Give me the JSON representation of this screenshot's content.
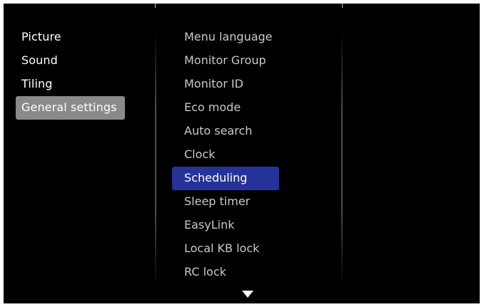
{
  "left_menu": {
    "items": [
      {
        "label": "Picture"
      },
      {
        "label": "Sound"
      },
      {
        "label": "Tiling"
      },
      {
        "label": "General settings"
      }
    ],
    "active_label": "General settings"
  },
  "right_menu": {
    "items": [
      {
        "label": "Menu language"
      },
      {
        "label": "Monitor Group"
      },
      {
        "label": "Monitor ID"
      },
      {
        "label": "Eco mode"
      },
      {
        "label": "Auto search"
      },
      {
        "label": "Clock"
      },
      {
        "label": "Scheduling"
      },
      {
        "label": "Sleep timer"
      },
      {
        "label": "EasyLink"
      },
      {
        "label": "Local KB lock"
      },
      {
        "label": "RC lock"
      }
    ],
    "selected_label": "Scheduling"
  },
  "icons": {
    "scroll_down": "down-arrow-icon"
  },
  "colors": {
    "background": "#000000",
    "active_left": "#8a8a8a",
    "selected_right": "#25329a",
    "text_primary": "#ffffff",
    "text_secondary": "#c9c9c9"
  }
}
